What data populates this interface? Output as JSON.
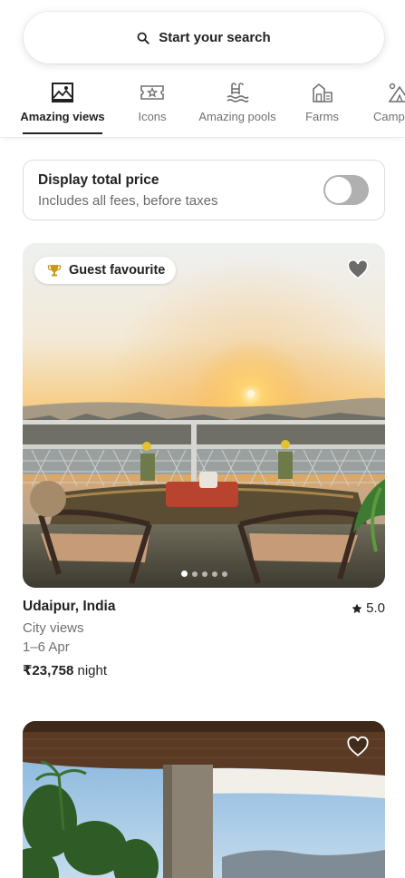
{
  "search": {
    "label": "Start your search"
  },
  "categories": [
    {
      "label": "Amazing views",
      "icon": "amazing-views-icon",
      "active": true
    },
    {
      "label": "Icons",
      "icon": "icons-ticket-icon",
      "active": false
    },
    {
      "label": "Amazing pools",
      "icon": "pool-icon",
      "active": false
    },
    {
      "label": "Farms",
      "icon": "farm-icon",
      "active": false
    },
    {
      "label": "Camp",
      "icon": "camping-icon",
      "active": false
    }
  ],
  "price_toggle": {
    "title": "Display total price",
    "subtitle": "Includes all fees, before taxes",
    "enabled": false
  },
  "listings": [
    {
      "badge": "Guest favourite",
      "location": "Udaipur, India",
      "rating": "5.0",
      "description": "City views",
      "dates": "1–6 Apr",
      "price": "₹23,758",
      "price_unit": "night",
      "photo_count": 5,
      "active_photo": 0
    }
  ],
  "colors": {
    "text": "#222222",
    "muted": "#717171",
    "border": "#dddddd",
    "toggle_off": "#b0b0b0"
  }
}
